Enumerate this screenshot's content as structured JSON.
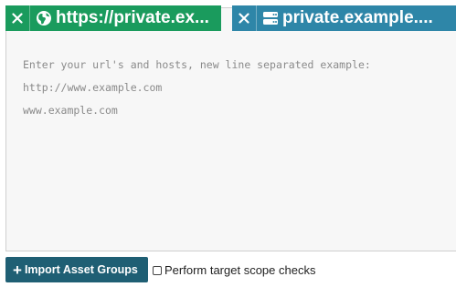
{
  "chips": [
    {
      "label": "https://private.ex...",
      "icon": "globe-icon",
      "color": "#1a9b5d"
    },
    {
      "label": "private.example....",
      "icon": "server-icon",
      "color": "#2e86a8"
    }
  ],
  "editor": {
    "placeholder_lines": [
      "Enter your url's and hosts, new line separated example:",
      "http://www.example.com",
      "www.example.com"
    ]
  },
  "import_button": {
    "label": "Import Asset Groups",
    "icon": "plus-icon"
  },
  "scope_check": {
    "label": "Perform target scope checks",
    "checked": false
  }
}
